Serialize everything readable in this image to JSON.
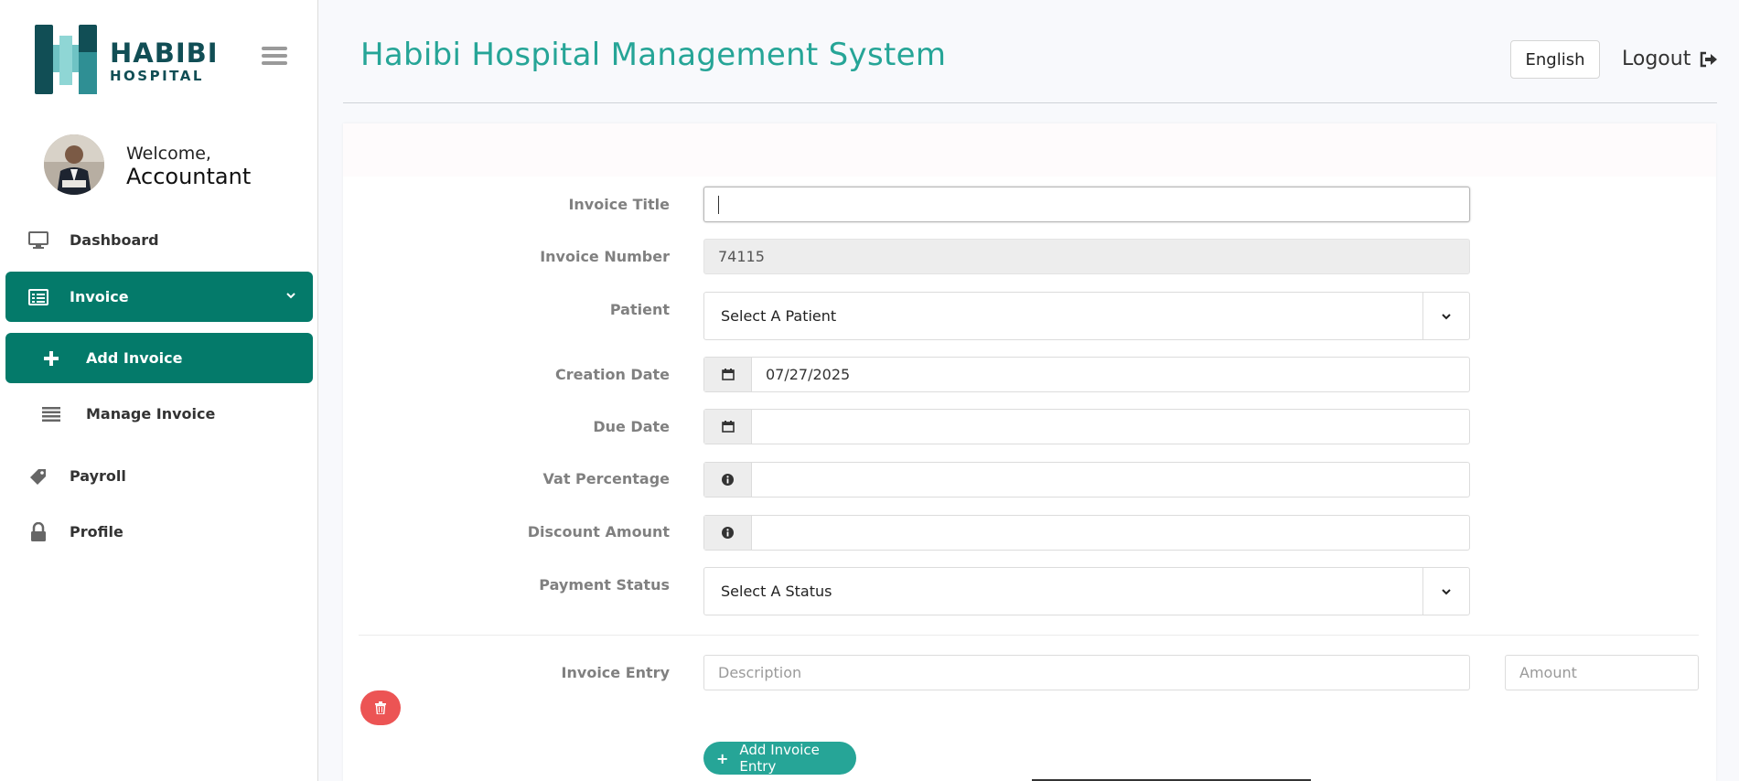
{
  "brand": {
    "logo_line1": "HABIBI",
    "logo_line2": "HOSPITAL",
    "accent_color": "#047a6a",
    "title_color": "#26a597"
  },
  "user": {
    "welcome": "Welcome,",
    "name": "Accountant"
  },
  "sidebar": {
    "items": [
      {
        "label": "Dashboard",
        "icon": "monitor-icon"
      },
      {
        "label": "Invoice",
        "icon": "invoice-icon",
        "active": true
      },
      {
        "label": "Add Invoice",
        "icon": "plus-icon",
        "active": true
      },
      {
        "label": "Manage Invoice",
        "icon": "list-icon"
      },
      {
        "label": "Payroll",
        "icon": "tag-icon"
      },
      {
        "label": "Profile",
        "icon": "lock-icon"
      }
    ]
  },
  "header": {
    "title": "Habibi Hospital Management System",
    "language": "English",
    "logout": "Logout"
  },
  "form": {
    "invoice_title_label": "Invoice Title",
    "invoice_title_value": "",
    "invoice_number_label": "Invoice Number",
    "invoice_number_value": "74115",
    "patient_label": "Patient",
    "patient_value": "Select A Patient",
    "creation_date_label": "Creation Date",
    "creation_date_value": "07/27/2025",
    "due_date_label": "Due Date",
    "due_date_value": "",
    "vat_label": "Vat Percentage",
    "vat_value": "",
    "discount_label": "Discount Amount",
    "discount_value": "",
    "payment_status_label": "Payment Status",
    "payment_status_value": "Select A Status",
    "invoice_entry_label": "Invoice Entry",
    "description_placeholder": "Description",
    "amount_placeholder": "Amount",
    "add_entry_label": "Add Invoice Entry",
    "delete_color": "#ec5454"
  }
}
